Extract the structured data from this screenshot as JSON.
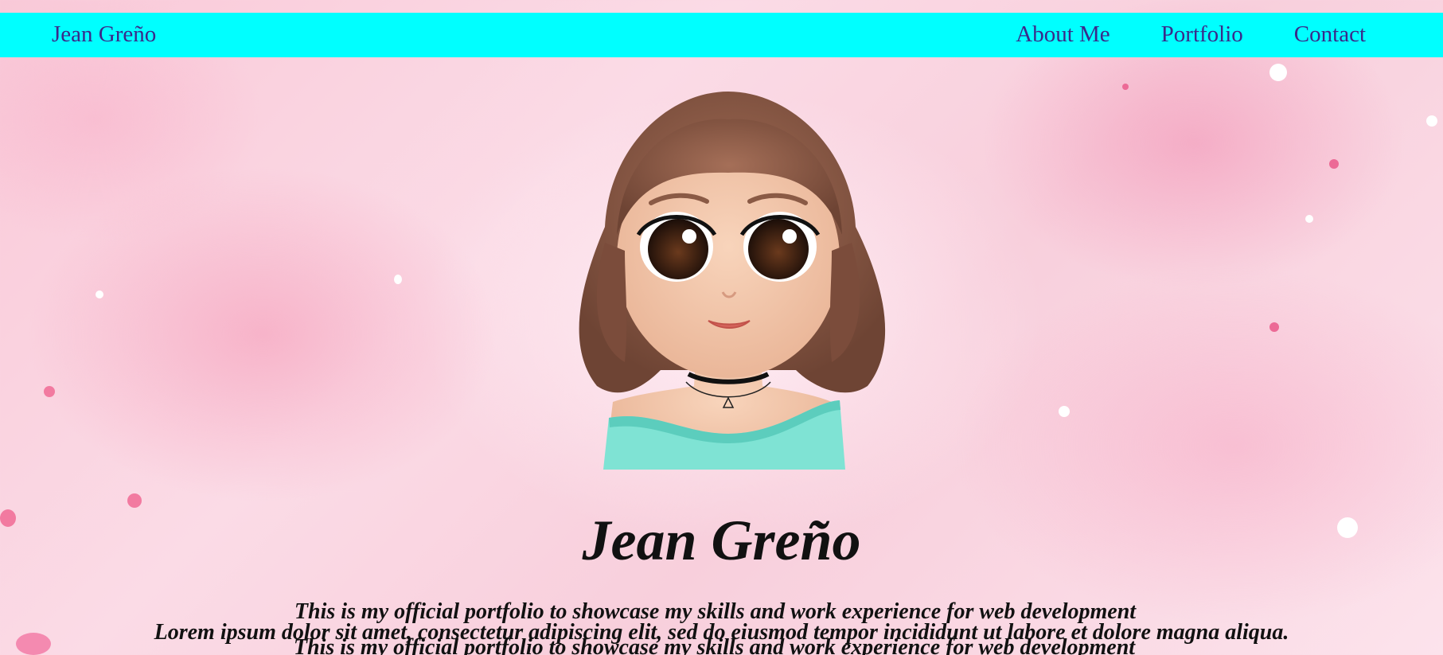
{
  "nav": {
    "brand": "Jean Greño",
    "links": [
      "About Me",
      "Portfolio",
      "Contact"
    ]
  },
  "hero": {
    "avatar_alt": "cartoon avatar of Jean",
    "name": "Jean Greño",
    "tagline": "This is my official portfolio to showcase my skills and work experience for web development",
    "lorem": "Lorem ipsum dolor sit amet, consectetur adipiscing elit, sed do eiusmod tempor incididunt ut labore et dolore magna aliqua.",
    "tagline_repeat": "This is my official portfolio to showcase my skills and work experience for web development"
  },
  "colors": {
    "navbar": "#00ffff",
    "nav_text": "#3a2a8a",
    "background": "#f9c9d8",
    "shirt": "#7fe3d4",
    "hair": "#8a5a45"
  }
}
